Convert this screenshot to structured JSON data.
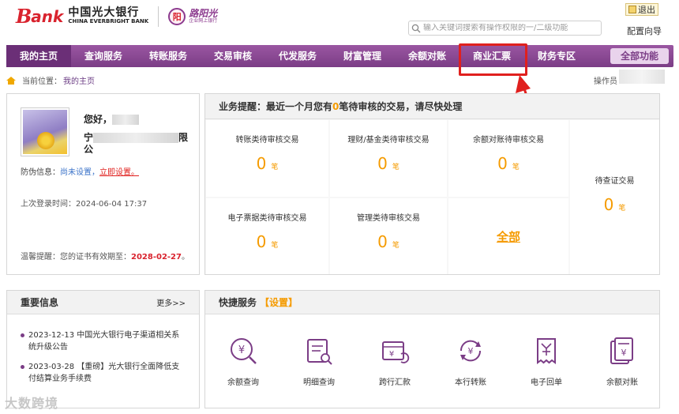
{
  "header": {
    "logo_b": "B",
    "logo_ank": "ank",
    "logo_cn": "中国光大银行",
    "logo_en": "CHINA EVERBRIGHT BANK",
    "partner_cn": "路阳光",
    "partner_sub": "企业网上银行",
    "partner_badge": "阳",
    "search_placeholder": "输入关键词搜索有操作权限的一/二级功能",
    "logout": "退出",
    "guide": "配置向导"
  },
  "nav": {
    "items": [
      "我的主页",
      "查询服务",
      "转账服务",
      "交易审核",
      "代发服务",
      "财富管理",
      "余额对账",
      "商业汇票",
      "财务专区"
    ],
    "all": "全部功能"
  },
  "breadcrumb": {
    "prefix": "当前位置：",
    "current": "我的主页",
    "operator": "操作员"
  },
  "user": {
    "greeting": "您好，",
    "company_start": "宁",
    "company_end": "限",
    "company_line2": "公",
    "defense_label": "防伪信息：",
    "defense_not_set": "尚未设置，",
    "defense_set_now": "立即设置。",
    "last_login_label": "上次登录时间：",
    "last_login": "2024-06-04 17:37",
    "cert_label": "温馨提醒：您的证书有效期至：",
    "cert_date": "2028-02-27",
    "cert_end": "。"
  },
  "pending": {
    "title_pre": "业务提醒：最近一个月您有",
    "title_count": "0",
    "title_post": "笔待审核的交易，请尽快处理",
    "unit": "笔",
    "cells": [
      {
        "label": "转账类待审核交易",
        "value": "0"
      },
      {
        "label": "理财/基金类待审核交易",
        "value": "0"
      },
      {
        "label": "余额对账待审核交易",
        "value": "0"
      },
      {
        "label": "电子票据类待审核交易",
        "value": "0"
      },
      {
        "label": "管理类待审核交易",
        "value": "0"
      }
    ],
    "all": "全部",
    "side_label": "待查证交易",
    "side_value": "0"
  },
  "news": {
    "title": "重要信息",
    "more": "更多>>",
    "items": [
      "2023-12-13 中国光大银行电子渠道相关系统升级公告",
      "2023-03-28 【重磅】光大银行全面降低支付结算业务手续费"
    ]
  },
  "quick": {
    "title": "快捷服务",
    "settings": "【设置】",
    "items": [
      {
        "label": "余额查询",
        "icon": "balance-query-icon"
      },
      {
        "label": "明细查询",
        "icon": "detail-query-icon"
      },
      {
        "label": "跨行汇款",
        "icon": "interbank-transfer-icon"
      },
      {
        "label": "本行转账",
        "icon": "intrabank-transfer-icon"
      },
      {
        "label": "电子回单",
        "icon": "e-receipt-icon"
      },
      {
        "label": "余额对账",
        "icon": "balance-reconcile-icon"
      }
    ]
  },
  "watermark": "大数跨境",
  "colors": {
    "brand_purple": "#7b3d86",
    "accent_orange": "#f59b00",
    "brand_red": "#d9232e",
    "highlight": "#e0201e"
  }
}
